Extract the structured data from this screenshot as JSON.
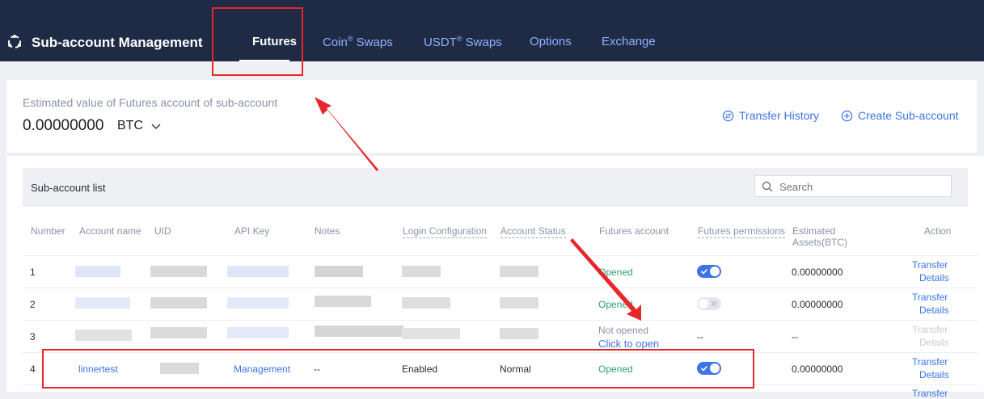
{
  "header": {
    "title": "Sub-account Management",
    "tabs": [
      {
        "label": "Futures",
        "active": true
      },
      {
        "label": "Coin",
        "sup": "®",
        "suffix": " Swaps"
      },
      {
        "label": "USDT",
        "sup": "®",
        "suffix": " Swaps"
      },
      {
        "label": "Options"
      },
      {
        "label": "Exchange"
      }
    ]
  },
  "summary": {
    "label": "Estimated value of Futures account of sub-account",
    "value": "0.00000000",
    "unit": "BTC",
    "transfer_history": "Transfer History",
    "create_sub_account": "Create Sub-account"
  },
  "list": {
    "title": "Sub-account list",
    "search_placeholder": "Search",
    "columns": {
      "number": "Number",
      "account_name": "Account name",
      "uid": "UID",
      "api_key": "API Key",
      "notes": "Notes",
      "login_configuration": "Login Configuration",
      "account_status": "Account Status",
      "futures_account": "Futures account",
      "futures_permissions": "Futures permissions",
      "estimated_assets_1": "Estimated",
      "estimated_assets_2": "Assets(BTC)",
      "action": "Action"
    },
    "rows": [
      {
        "number": "1",
        "futures_account": "Opened",
        "permission": "on",
        "assets": "0.00000000",
        "action_1": "Transfer",
        "action_2": "Details"
      },
      {
        "number": "2",
        "futures_account": "Opened",
        "permission": "off",
        "assets": "0.00000000",
        "action_1": "Transfer",
        "action_2": "Details"
      },
      {
        "number": "3",
        "futures_account": "Not opened",
        "futures_account_link": "Click to open",
        "permission": "--",
        "assets": "--",
        "action_1": "Transfer",
        "action_2": "Details"
      },
      {
        "number": "4",
        "account_name": "linnertest",
        "api_key": "Management",
        "notes": "--",
        "login_configuration": "Enabled",
        "account_status": "Normal",
        "futures_account": "Opened",
        "permission": "on",
        "assets": "0.00000000",
        "action_1": "Transfer",
        "action_2": "Details"
      }
    ],
    "partial_row_action": "Transfer"
  },
  "colors": {
    "topbar": "#1f2a44",
    "accent": "#3d74e6",
    "opened": "#2ea26b",
    "annotation": "#e6262a"
  },
  "icons": [
    "logo-icon",
    "chevron-down-icon",
    "transfer-history-icon",
    "plus-circle-icon",
    "search-icon",
    "check-icon",
    "x-icon",
    "arrow-annotation"
  ]
}
